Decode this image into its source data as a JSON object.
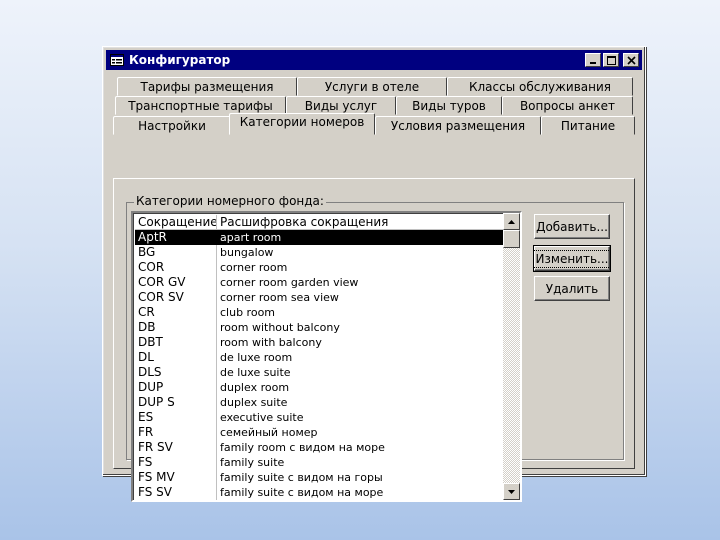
{
  "window": {
    "title": "Конфигуратор",
    "title_icon": "form-icon",
    "controls": [
      "minimize-icon",
      "maximize-icon",
      "close-icon"
    ]
  },
  "tabs": {
    "row1": [
      "Тарифы размещения",
      "Услуги в отеле",
      "Классы обслуживания"
    ],
    "row2": [
      "Транспортные тарифы",
      "Виды услуг",
      "Виды туров",
      "Вопросы анкет"
    ],
    "row3": [
      "Настройки",
      "Категории номеров",
      "Условия размещения",
      "Питание"
    ],
    "active": "Категории номеров"
  },
  "group": {
    "label": "Категории номерного фонда:"
  },
  "list": {
    "columns": [
      "Сокращение",
      "Расшифровка сокращения"
    ],
    "rows": [
      {
        "code": "AptR",
        "description": "apart room",
        "selected": true
      },
      {
        "code": "BG",
        "description": "bungalow"
      },
      {
        "code": "COR",
        "description": "corner room"
      },
      {
        "code": "COR GV",
        "description": "corner room garden view"
      },
      {
        "code": "COR SV",
        "description": "corner room sea view"
      },
      {
        "code": "CR",
        "description": "club room"
      },
      {
        "code": "DB",
        "description": "room without balcony"
      },
      {
        "code": "DBT",
        "description": "room with balcony"
      },
      {
        "code": "DL",
        "description": "de luxe room"
      },
      {
        "code": "DLS",
        "description": "de luxe suite"
      },
      {
        "code": "DUP",
        "description": "duplex room"
      },
      {
        "code": "DUP S",
        "description": "duplex suite"
      },
      {
        "code": "ES",
        "description": "executive suite"
      },
      {
        "code": "FR",
        "description": "семейный номер"
      },
      {
        "code": "FR SV",
        "description": "family room с видом на море"
      },
      {
        "code": "FS",
        "description": "family suite"
      },
      {
        "code": "FS MV",
        "description": "family suite с видом на горы"
      },
      {
        "code": "FS SV",
        "description": "family suite с видом на море"
      }
    ],
    "scroll_up_icon": "arrow-up-icon",
    "scroll_down_icon": "arrow-down-icon"
  },
  "buttons": {
    "add": "Добавить...",
    "edit": "Изменить...",
    "delete": "Удалить"
  }
}
